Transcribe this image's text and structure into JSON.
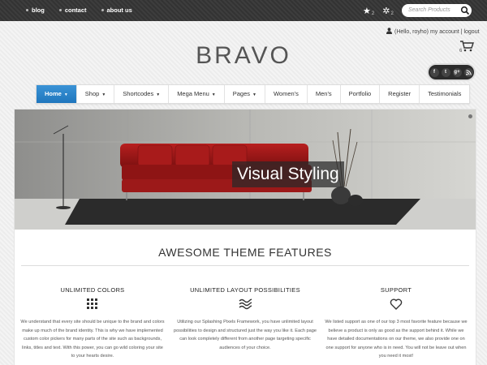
{
  "topbar": {
    "links": [
      "blog",
      "contact",
      "about us"
    ],
    "wishlist_count": "2",
    "compare_count": "2",
    "search_placeholder": "Search Products"
  },
  "account": {
    "text": "(Hello, royho) my account | logout",
    "cart_count": "6"
  },
  "logo": "BRAVO",
  "social": [
    "f",
    "t",
    "g+",
    "rss"
  ],
  "nav": [
    {
      "label": "Home",
      "has_caret": true,
      "active": true
    },
    {
      "label": "Shop",
      "has_caret": true,
      "active": false
    },
    {
      "label": "Shortcodes",
      "has_caret": true,
      "active": false
    },
    {
      "label": "Mega Menu",
      "has_caret": true,
      "active": false
    },
    {
      "label": "Pages",
      "has_caret": true,
      "active": false
    },
    {
      "label": "Women's",
      "has_caret": false,
      "active": false
    },
    {
      "label": "Men's",
      "has_caret": false,
      "active": false
    },
    {
      "label": "Portfolio",
      "has_caret": false,
      "active": false
    },
    {
      "label": "Register",
      "has_caret": false,
      "active": false
    },
    {
      "label": "Testimonials",
      "has_caret": false,
      "active": false
    }
  ],
  "slider": {
    "caption": "Visual Styling"
  },
  "features": {
    "title": "AWESOME THEME FEATURES",
    "items": [
      {
        "title": "UNLIMITED COLORS",
        "icon": "grid-icon",
        "text": "We understand that every site should be unique to the brand and colors make up much of the brand identity. This is why we have implemented custom color pickers for many parts of the site such as backgrounds, links, titles and text. With this power, you can go wild coloring your site to your hearts desire."
      },
      {
        "title": "UNLIMITED LAYOUT POSSIBILITIES",
        "icon": "waves-icon",
        "text": "Utilizing our Splashing Pixels Framework, you have unlimited layout possibilities to design and structured just the way you like it. Each page can look completely different from another page targeting specific audiences of your choice."
      },
      {
        "title": "SUPPORT",
        "icon": "heart-icon",
        "text": "We listed support as one of our top 3 most favorite feature because we believe a product is only as good as the support behind it. While we have detailed documentations on our theme, we also provide one on one support for anyone who is in need. You will not be leave out when you need it most!"
      }
    ]
  },
  "colors": {
    "accent": "#2a84c9",
    "topbar": "#3a3a3a",
    "sofa": "#a31a1a"
  }
}
